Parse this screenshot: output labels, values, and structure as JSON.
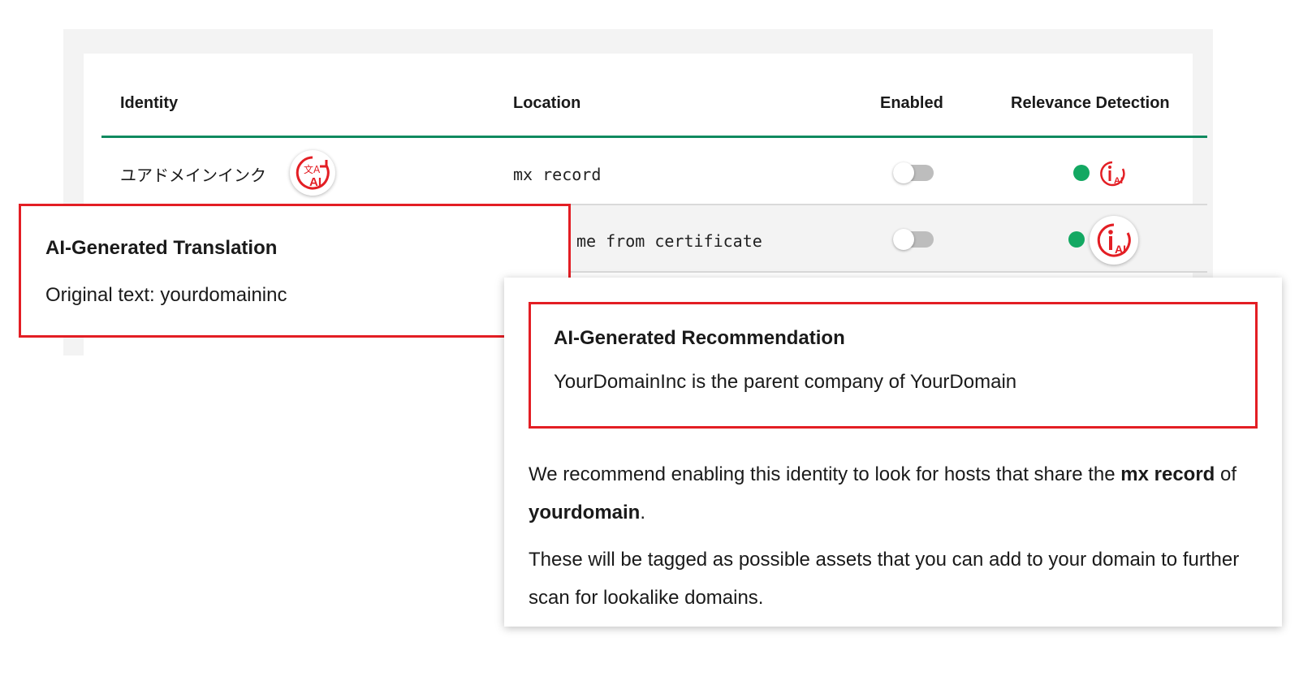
{
  "table": {
    "headers": {
      "identity": "Identity",
      "location": "Location",
      "enabled": "Enabled",
      "relevance": "Relevance Detection"
    },
    "rows": [
      {
        "identity": "ユアドメインインク",
        "location": "mx record",
        "enabled": false,
        "relevance_status": "active"
      },
      {
        "identity": "",
        "location": "me from certificate",
        "enabled": false,
        "relevance_status": "active"
      }
    ]
  },
  "translation_popover": {
    "title": "AI-Generated Translation",
    "body": "Original text: yourdomaininc"
  },
  "recommendation_popover": {
    "title": "AI-Generated Recommendation",
    "summary": "YourDomainInc is the parent company of YourDomain",
    "para1": {
      "part1": "We recommend enabling this identity to look for hosts that share the ",
      "bold1": "mx record",
      "part2": " of ",
      "bold2": "yourdomain",
      "part3": "."
    },
    "para2": "These will be tagged as possible assets that you can add to your domain to further scan for lookalike domains."
  },
  "icons": {
    "ai_text": "AI",
    "translate_glyph": "文A"
  },
  "colors": {
    "accent_red": "#e31e24",
    "header_rule_green": "#0f8a5f",
    "status_green": "#13a862",
    "toggle_off": "#bdbdbd"
  }
}
